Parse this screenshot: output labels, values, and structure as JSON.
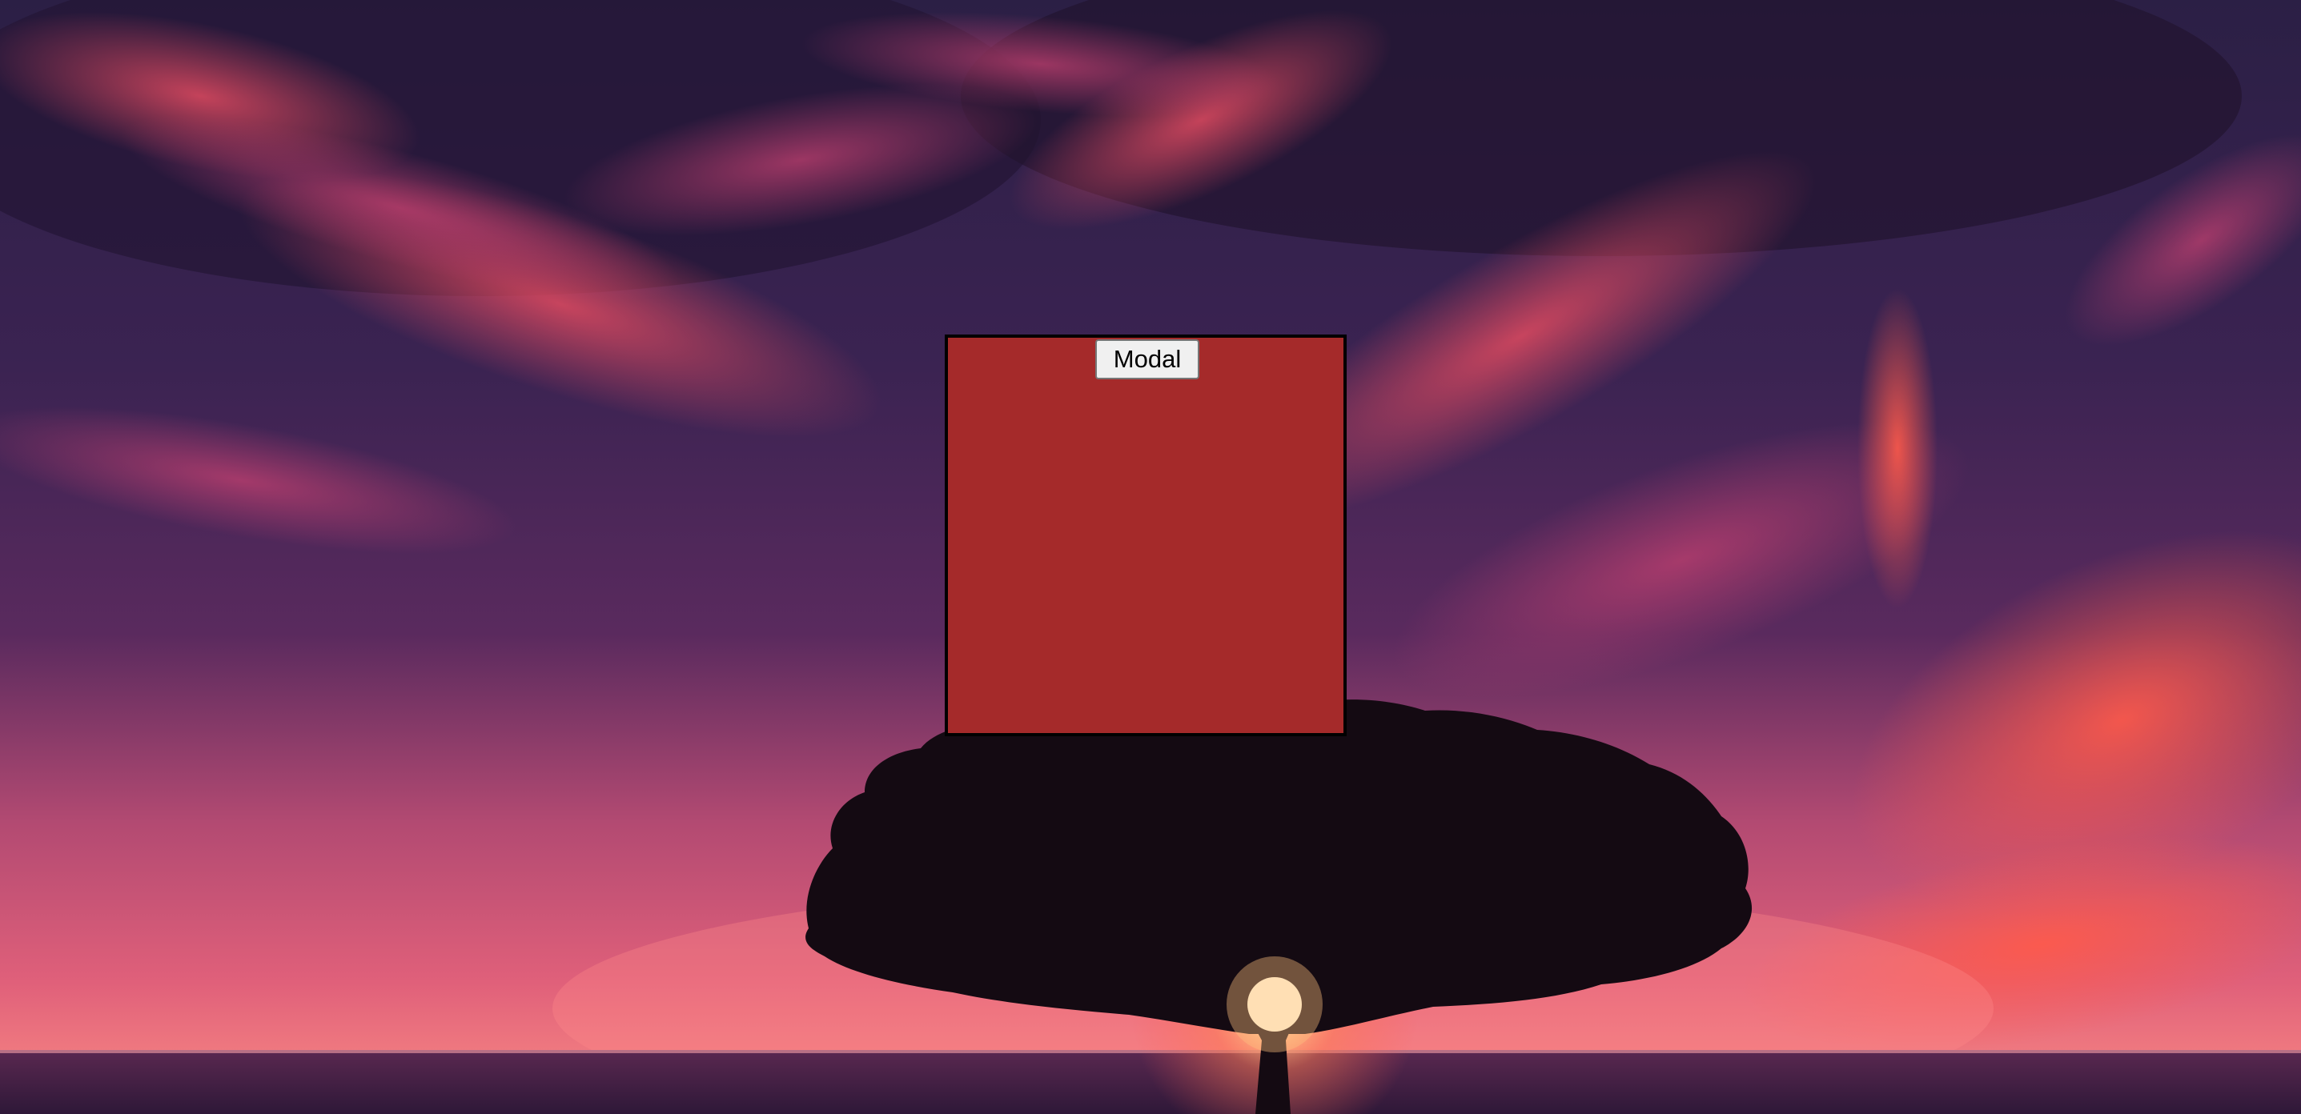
{
  "modal_button": {
    "label": "Modal"
  },
  "background": {
    "description_icon": "sunset-tree-wallpaper-icon"
  },
  "colors": {
    "modal_box": "#a52a2a",
    "modal_border": "#000000",
    "button_bg": "#f0f0f0",
    "sky_top": "#2b1f45",
    "sky_mid": "#5a2a5e",
    "horizon": "#e0607a",
    "sea": "#3a1e3e"
  }
}
